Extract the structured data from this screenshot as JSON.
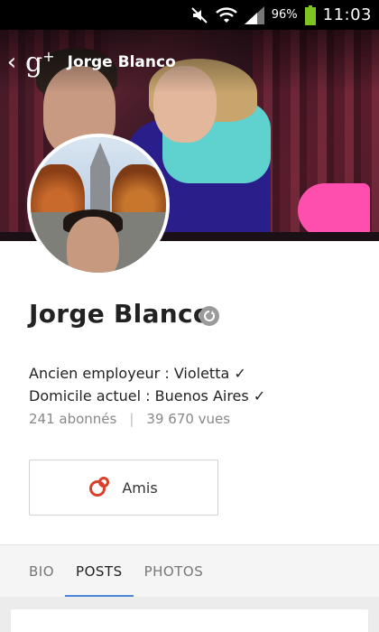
{
  "status_bar": {
    "battery_percent": "96%",
    "time": "11:03",
    "icons": [
      "mute-icon",
      "wifi-icon",
      "signal-icon",
      "battery-icon"
    ]
  },
  "header": {
    "back_icon": "chevron-left-icon",
    "logo": "g+",
    "title": "Jorge Blanco"
  },
  "profile": {
    "name": "Jorge Blanco",
    "badge_icon": "verified-icon",
    "employer_line": "Ancien employeur : Violetta ✓",
    "residence_line": "Domicile actuel : Buenos Aires ✓",
    "followers": "241 abonnés",
    "stats_separator": "|",
    "views": "39 670 vues",
    "friends_button": {
      "label": "Amis",
      "icon": "circles-icon"
    }
  },
  "tabs": [
    {
      "label": "BIO",
      "active": false
    },
    {
      "label": "POSTS",
      "active": true
    },
    {
      "label": "PHOTOS",
      "active": false
    }
  ],
  "colors": {
    "accent": "#4a86d8",
    "circles_red": "#d9412c",
    "badge_gray": "#9a9a9a"
  }
}
